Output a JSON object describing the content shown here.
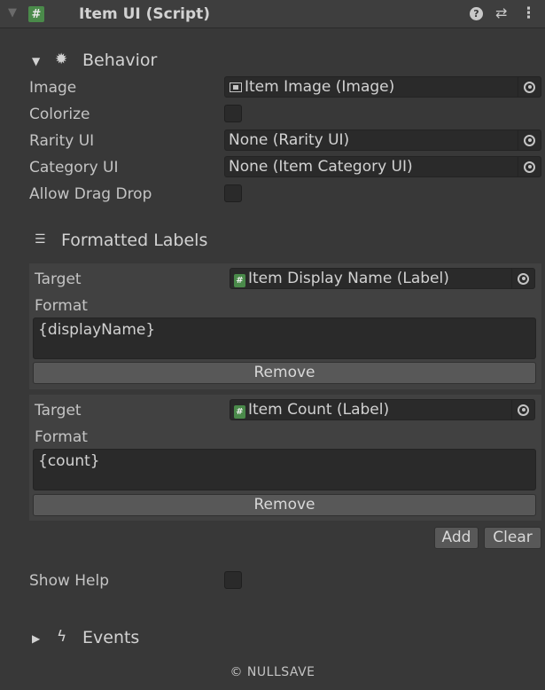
{
  "header": {
    "title": "Item UI (Script)"
  },
  "behavior": {
    "section_title": "Behavior",
    "image": {
      "label": "Image",
      "value": "Item Image (Image)"
    },
    "colorize": {
      "label": "Colorize"
    },
    "rarity": {
      "label": "Rarity UI",
      "value": "None (Rarity UI)"
    },
    "category": {
      "label": "Category UI",
      "value": "None (Item Category UI)"
    },
    "allow_drag_drop": {
      "label": "Allow Drag Drop"
    }
  },
  "formatted_labels": {
    "section_title": "Formatted Labels",
    "items": [
      {
        "target_label": "Target",
        "target_value": "Item Display Name (Label)",
        "format_label": "Format",
        "format_value": "{displayName}",
        "remove_label": "Remove"
      },
      {
        "target_label": "Target",
        "target_value": "Item Count (Label)",
        "format_label": "Format",
        "format_value": "{count}",
        "remove_label": "Remove"
      }
    ],
    "add_label": "Add",
    "clear_label": "Clear"
  },
  "show_help": {
    "label": "Show Help"
  },
  "events": {
    "section_title": "Events"
  },
  "footer": {
    "text": "© NULLSAVE"
  }
}
